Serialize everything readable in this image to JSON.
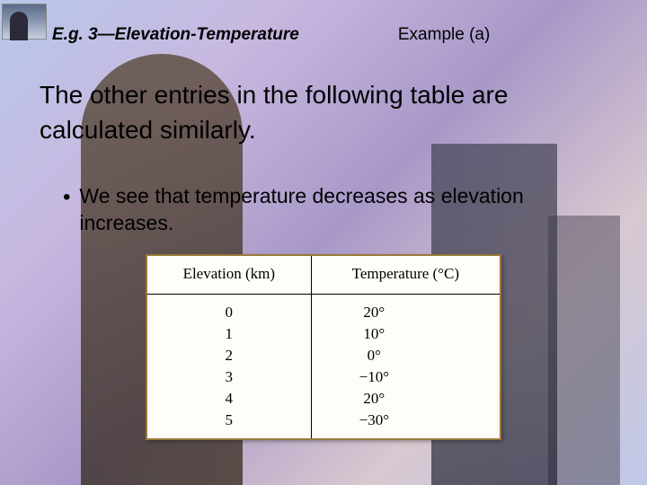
{
  "header": {
    "left": "E.g. 3—Elevation-Temperature",
    "right": "Example (a)"
  },
  "main_text": "The other entries in the following table are calculated similarly.",
  "bullet": "We see that temperature decreases as elevation increases.",
  "table": {
    "headers": {
      "c1": "Elevation (km)",
      "c2": "Temperature (°C)"
    },
    "rows": [
      {
        "elev": "0",
        "temp": "20°"
      },
      {
        "elev": "1",
        "temp": "10°"
      },
      {
        "elev": "2",
        "temp": "0°"
      },
      {
        "elev": "3",
        "temp": "−10°"
      },
      {
        "elev": "4",
        "temp": "20°"
      },
      {
        "elev": "5",
        "temp": "−30°"
      }
    ]
  },
  "chart_data": {
    "type": "table",
    "title": "Elevation vs Temperature",
    "columns": [
      "Elevation (km)",
      "Temperature (°C)"
    ],
    "data": [
      {
        "elevation_km": 0,
        "temperature_c": 20
      },
      {
        "elevation_km": 1,
        "temperature_c": 10
      },
      {
        "elevation_km": 2,
        "temperature_c": 0
      },
      {
        "elevation_km": 3,
        "temperature_c": -10
      },
      {
        "elevation_km": 4,
        "temperature_c": 20
      },
      {
        "elevation_km": 5,
        "temperature_c": -30
      }
    ]
  }
}
